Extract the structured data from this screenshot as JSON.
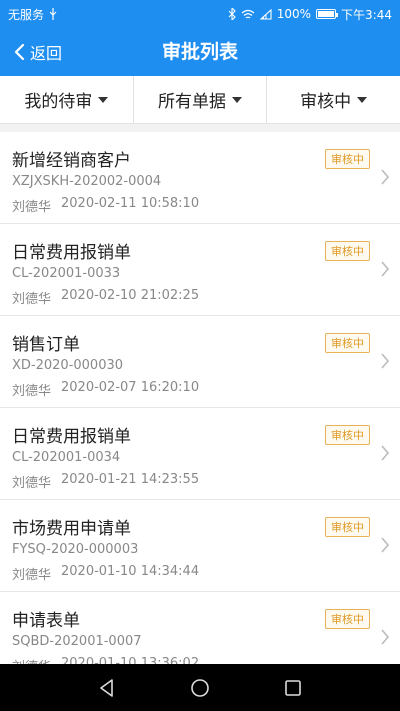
{
  "status": {
    "carrier": "无服务",
    "battery": "100%",
    "battery_level": 1.0,
    "time": "下午3:44"
  },
  "nav": {
    "back_label": "返回",
    "title": "审批列表"
  },
  "filters": [
    {
      "label": "我的待审"
    },
    {
      "label": "所有单据"
    },
    {
      "label": "审核中"
    }
  ],
  "items": [
    {
      "title": "新增经销商客户",
      "code": "XZJXSKH-202002-0004",
      "user": "刘德华",
      "datetime": "2020-02-11 10:58:10",
      "status": "审核中"
    },
    {
      "title": "日常费用报销单",
      "code": "CL-202001-0033",
      "user": "刘德华",
      "datetime": "2020-02-10 21:02:25",
      "status": "审核中"
    },
    {
      "title": "销售订单",
      "code": "XD-2020-000030",
      "user": "刘德华",
      "datetime": "2020-02-07 16:20:10",
      "status": "审核中"
    },
    {
      "title": "日常费用报销单",
      "code": "CL-202001-0034",
      "user": "刘德华",
      "datetime": "2020-01-21 14:23:55",
      "status": "审核中"
    },
    {
      "title": "市场费用申请单",
      "code": "FYSQ-2020-000003",
      "user": "刘德华",
      "datetime": "2020-01-10 14:34:44",
      "status": "审核中"
    },
    {
      "title": "申请表单",
      "code": "SQBD-202001-0007",
      "user": "刘德华",
      "datetime": "2020-01-10 13:36:02",
      "status": "审核中"
    }
  ],
  "icons": {
    "back": "chevron-left-icon",
    "item_arrow": "chevron-right-icon",
    "filter_caret": "caret-down-icon"
  },
  "colors": {
    "primary": "#1f8ef1",
    "badge": "#e09a25"
  }
}
